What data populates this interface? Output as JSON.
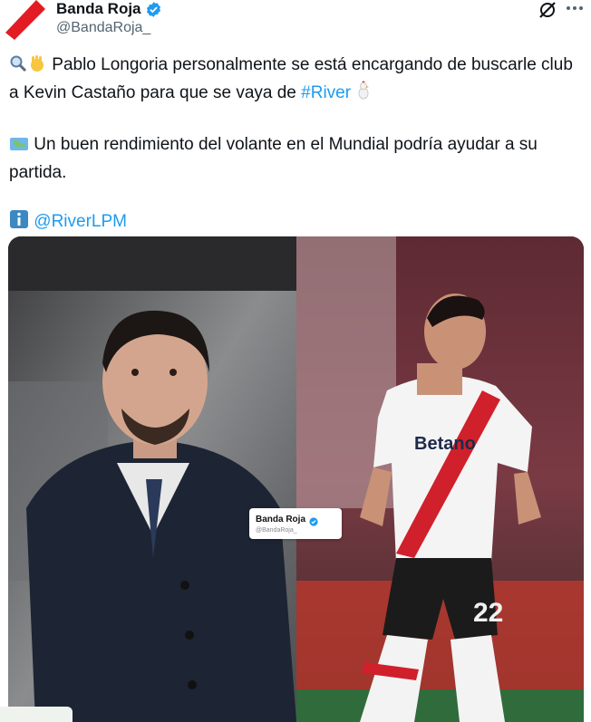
{
  "author": {
    "display_name": "Banda Roja",
    "handle": "@BandaRoja_"
  },
  "icons": {
    "verified": "verified-badge-icon",
    "grok": "grok-icon",
    "more": "more-options-icon"
  },
  "tweet": {
    "line1_text": "Pablo Longoria personalmente se está encargando de buscarle club a Kevin Castaño para que se vaya de",
    "line1_hashtag": "#River",
    "line2_text": "Un buen rendimiento del volante en el Mundial podría ayudar a su partida.",
    "line3_mention": "@RiverLPM"
  },
  "media": {
    "watermark_name": "Banda Roja",
    "watermark_handle": "@BandaRoja_"
  },
  "colors": {
    "link": "#1d9bf0",
    "verified": "#1d9bf0",
    "text": "#0f1419",
    "secondary": "#536471"
  }
}
